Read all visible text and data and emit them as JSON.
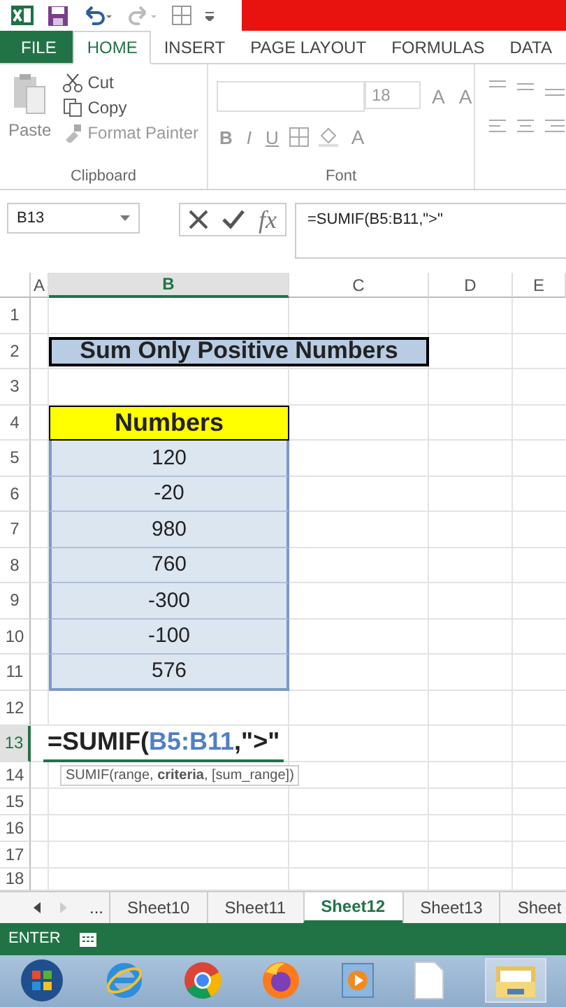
{
  "ribbon_tabs": [
    {
      "label": "FILE",
      "kind": "file",
      "selected": false
    },
    {
      "label": "HOME",
      "kind": "tab",
      "selected": true
    },
    {
      "label": "INSERT",
      "kind": "tab",
      "selected": false
    },
    {
      "label": "PAGE LAYOUT",
      "kind": "tab",
      "selected": false
    },
    {
      "label": "FORMULAS",
      "kind": "tab",
      "selected": false
    },
    {
      "label": "DATA",
      "kind": "tab",
      "selected": false
    }
  ],
  "clipboard": {
    "paste": "Paste",
    "cut": "Cut",
    "copy": "Copy",
    "format_painter": "Format Painter",
    "label": "Clipboard"
  },
  "font": {
    "size": "18",
    "size_buttons": [
      "A",
      "A"
    ],
    "style_buttons": [
      "B",
      "I",
      "U"
    ],
    "color_button": "A",
    "label": "Font"
  },
  "formula_bar": {
    "name_box": "B13",
    "function_button": "fx",
    "formula": "=SUMIF(B5:B11,\">\""
  },
  "columns": [
    {
      "label": "A",
      "selected": false
    },
    {
      "label": "B",
      "selected": true
    },
    {
      "label": "C",
      "selected": false
    },
    {
      "label": "D",
      "selected": false
    },
    {
      "label": "E",
      "selected": false
    }
  ],
  "rows": [
    {
      "label": "1",
      "selected": false
    },
    {
      "label": "2",
      "selected": false,
      "cell": {
        "kind": "title",
        "text": "Sum Only Positive Numbers"
      }
    },
    {
      "label": "3",
      "selected": false
    },
    {
      "label": "4",
      "selected": false,
      "cell": {
        "kind": "heading",
        "text": "Numbers"
      }
    },
    {
      "label": "5",
      "selected": false,
      "cell": {
        "kind": "value",
        "text": "120"
      }
    },
    {
      "label": "6",
      "selected": false,
      "cell": {
        "kind": "value",
        "text": "-20"
      }
    },
    {
      "label": "7",
      "selected": false,
      "cell": {
        "kind": "value",
        "text": "980"
      }
    },
    {
      "label": "8",
      "selected": false,
      "cell": {
        "kind": "value",
        "text": "760"
      }
    },
    {
      "label": "9",
      "selected": false,
      "cell": {
        "kind": "value",
        "text": "-300"
      }
    },
    {
      "label": "10",
      "selected": false,
      "cell": {
        "kind": "value",
        "text": "-100"
      }
    },
    {
      "label": "11",
      "selected": false,
      "cell": {
        "kind": "value",
        "text": "576"
      }
    },
    {
      "label": "12",
      "selected": false
    },
    {
      "label": "13",
      "selected": true,
      "cell": {
        "kind": "formula",
        "parts": [
          {
            "kind": "plain",
            "text": "=SUMIF("
          },
          {
            "kind": "ref",
            "text": "B5:B11"
          },
          {
            "kind": "plain",
            "text": ",\">\""
          }
        ]
      }
    },
    {
      "label": "14",
      "selected": false,
      "cell": {
        "kind": "tooltip",
        "text": "SUMIF(range, **criteria**, [sum_range])"
      }
    },
    {
      "label": "15",
      "selected": false
    },
    {
      "label": "16",
      "selected": false
    },
    {
      "label": "17",
      "selected": false
    },
    {
      "label": "18",
      "selected": false
    }
  ],
  "sheet_tabs": {
    "more": "...",
    "tabs": [
      {
        "label": "Sheet10",
        "selected": false
      },
      {
        "label": "Sheet11",
        "selected": false
      },
      {
        "label": "Sheet12",
        "selected": true
      },
      {
        "label": "Sheet13",
        "selected": false
      },
      {
        "label": "Sheet",
        "selected": false
      }
    ]
  },
  "status_bar": {
    "mode": "ENTER"
  }
}
